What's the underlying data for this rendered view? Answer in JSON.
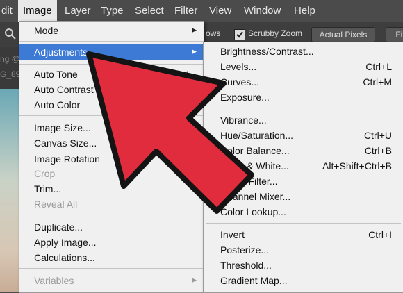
{
  "menubar": {
    "items": [
      "dit",
      "Image",
      "Layer",
      "Type",
      "Select",
      "Filter",
      "View",
      "Window",
      "Help"
    ],
    "active": "Image"
  },
  "options_bar": {
    "partial_left": "ows",
    "scrubby_zoom_label": "Scrubby Zoom",
    "scrubby_zoom_checked": true,
    "actual_pixels_label": "Actual Pixels",
    "fit_label": "Fit"
  },
  "doc_tab": {
    "line1": "ng @",
    "line2": "G_89"
  },
  "image_menu": [
    {
      "label": "Mode",
      "submenu": true
    },
    {
      "label": "Adjustments",
      "submenu": true,
      "highlighted": true
    },
    {
      "label": "Auto Tone",
      "shortcut": "Shift+Ctrl+L"
    },
    {
      "label": "Auto Contrast"
    },
    {
      "label": "Auto Color"
    },
    {
      "label": "Image Size..."
    },
    {
      "label": "Canvas Size..."
    },
    {
      "label": "Image Rotation"
    },
    {
      "label": "Crop",
      "disabled": true
    },
    {
      "label": "Trim..."
    },
    {
      "label": "Reveal All",
      "disabled": true
    },
    {
      "label": "Duplicate..."
    },
    {
      "label": "Apply Image..."
    },
    {
      "label": "Calculations..."
    },
    {
      "label": "Variables",
      "submenu": true,
      "disabled": true
    }
  ],
  "adjustments_menu": [
    {
      "label": "Brightness/Contrast..."
    },
    {
      "label": "Levels...",
      "shortcut": "Ctrl+L"
    },
    {
      "label": "Curves...",
      "shortcut": "Ctrl+M"
    },
    {
      "label": "Exposure..."
    },
    {
      "label": "Vibrance..."
    },
    {
      "label": "Hue/Saturation...",
      "shortcut": "Ctrl+U"
    },
    {
      "label": "Color Balance...",
      "shortcut": "Ctrl+B"
    },
    {
      "label": "Black & White...",
      "shortcut": "Alt+Shift+Ctrl+B"
    },
    {
      "label": "Photo Filter..."
    },
    {
      "label": "Channel Mixer..."
    },
    {
      "label": "Color Lookup..."
    },
    {
      "label": "Invert",
      "shortcut": "Ctrl+I"
    },
    {
      "label": "Posterize..."
    },
    {
      "label": "Threshold..."
    },
    {
      "label": "Gradient Map..."
    }
  ],
  "colors": {
    "highlight": "#3d7ad6",
    "arrow_fill": "#e02c3c",
    "arrow_stroke": "#141414"
  }
}
